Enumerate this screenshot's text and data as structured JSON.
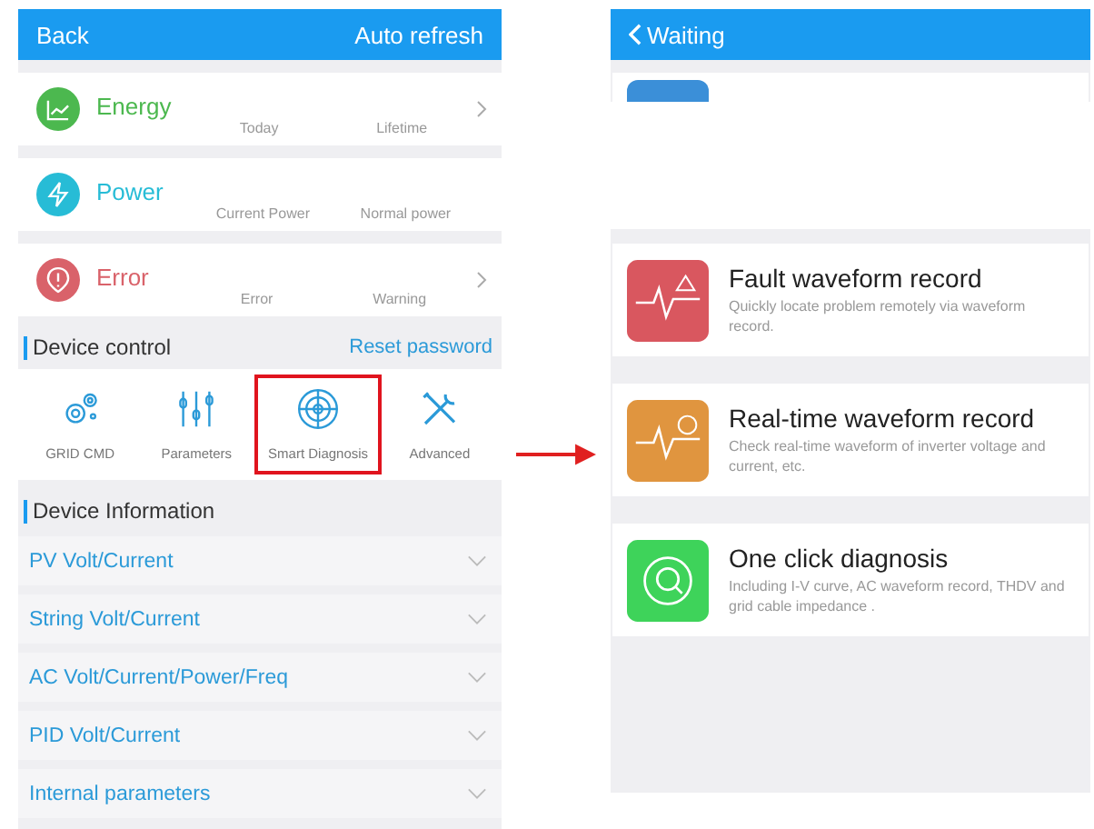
{
  "left_screen": {
    "header": {
      "back": "Back",
      "action": "Auto refresh"
    },
    "summary_cards": [
      {
        "kind": "energy",
        "title": "Energy",
        "labels": [
          "Today",
          "Lifetime"
        ],
        "chevron": true
      },
      {
        "kind": "power",
        "title": "Power",
        "labels": [
          "Current Power",
          "Normal power"
        ],
        "chevron": false
      },
      {
        "kind": "error",
        "title": "Error",
        "labels": [
          "Error",
          "Warning"
        ],
        "chevron": true
      }
    ],
    "device_control": {
      "title": "Device control",
      "link": "Reset password",
      "tools": [
        {
          "kind": "gears",
          "label": "GRID CMD",
          "highlighted": false
        },
        {
          "kind": "sliders",
          "label": "Parameters",
          "highlighted": false
        },
        {
          "kind": "target",
          "label": "Smart Diagnosis",
          "highlighted": true
        },
        {
          "kind": "tools",
          "label": "Advanced",
          "highlighted": false
        }
      ]
    },
    "device_information": {
      "title": "Device Information",
      "rows": [
        {
          "label": "PV Volt/Current",
          "expanded": false
        },
        {
          "label": "String Volt/Current",
          "expanded": false
        },
        {
          "label": "AC Volt/Current/Power/Freq",
          "expanded": false
        },
        {
          "label": "PID Volt/Current",
          "expanded": false
        },
        {
          "label": "Internal parameters",
          "expanded": false
        }
      ]
    }
  },
  "right_screen": {
    "header": {
      "title": "Waiting"
    },
    "records": [
      {
        "kind": "fault",
        "title": "Fault waveform record",
        "description": "Quickly locate problem remotely via waveform record."
      },
      {
        "kind": "realtime",
        "title": "Real-time waveform record",
        "description": "Check real-time waveform of inverter voltage and current, etc."
      },
      {
        "kind": "oneclick",
        "title": "One click diagnosis",
        "description": "Including I-V curve, AC waveform record, THDV and grid cable impedance ."
      }
    ]
  }
}
